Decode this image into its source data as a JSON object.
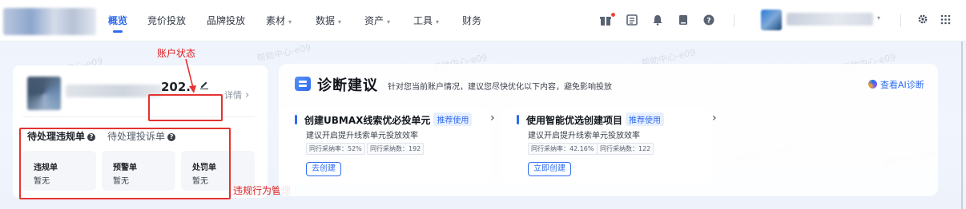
{
  "nav": {
    "items": [
      {
        "label": "概览",
        "active": true,
        "caret": false
      },
      {
        "label": "竞价投放",
        "active": false,
        "caret": false
      },
      {
        "label": "品牌投放",
        "active": false,
        "caret": false
      },
      {
        "label": "素材",
        "active": false,
        "caret": true
      },
      {
        "label": "数据",
        "active": false,
        "caret": true
      },
      {
        "label": "资产",
        "active": false,
        "caret": true
      },
      {
        "label": "工具",
        "active": false,
        "caret": true
      },
      {
        "label": "财务",
        "active": false,
        "caret": false
      }
    ],
    "caret_glyph": "▾",
    "icons": [
      "gift-icon",
      "list-icon",
      "bell-icon",
      "book-icon",
      "help-icon",
      "settings-icon",
      "apps-grid-icon"
    ],
    "accent": "#2d6bf0"
  },
  "watermark": "帮助中心-e09",
  "account": {
    "id_partial": "202.",
    "detail_label": "详情",
    "tabs": {
      "violation": "待处理违规单",
      "complaint": "待处理投诉单"
    },
    "stats": [
      {
        "label": "违规单",
        "value": "暂无"
      },
      {
        "label": "预警单",
        "value": "暂无"
      },
      {
        "label": "处罚单",
        "value": "暂无"
      }
    ]
  },
  "annotations": {
    "account_status": "账户状态",
    "violation_management": "违规行为管理",
    "color": "#e02020"
  },
  "diagnosis": {
    "title": "诊断建议",
    "subtitle": "针对您当前账户情况，建议您尽快优化以下内容，避免影响投放",
    "ai_link": "查看AI诊断",
    "suggestions": [
      {
        "title": "创建UBMAX线索优必投单元",
        "tag": "推荐使用",
        "desc": "建议开启提升线索单元投放效率",
        "chips": [
          "同行采纳率：52%",
          "同行采纳数：192"
        ],
        "action": "去创建"
      },
      {
        "title": "使用智能优选创建项目",
        "tag": "推荐使用",
        "desc": "建议开启提升线索单元投放效率",
        "chips": [
          "同行采纳率：42.16%",
          "同行采纳数：122"
        ],
        "action": "立即创建"
      }
    ]
  }
}
